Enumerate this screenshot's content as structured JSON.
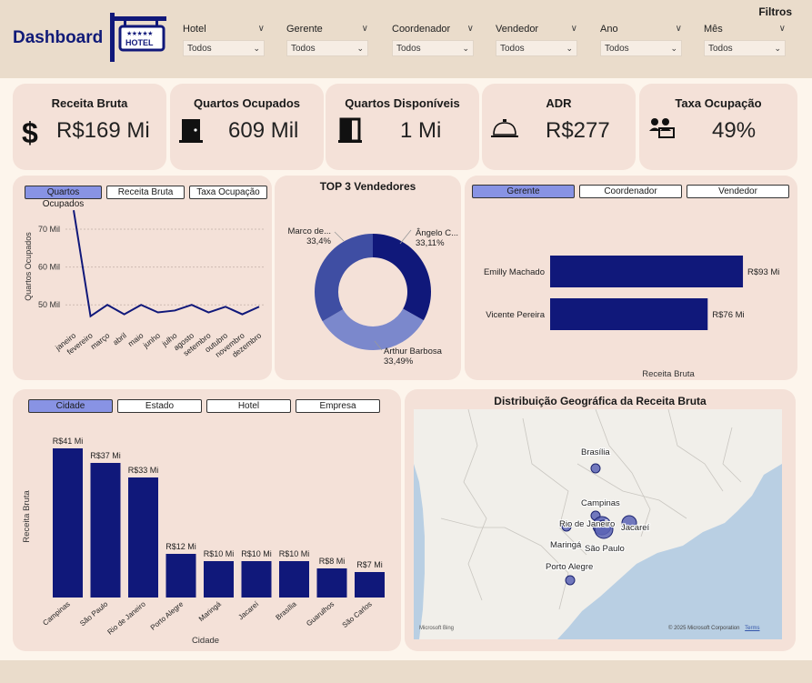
{
  "header": {
    "title": "Dashboard",
    "logo_text": "HOTEL",
    "logo_stars": "★★★★★",
    "filters_title": "Filtros",
    "filters": [
      {
        "label": "Hotel",
        "value": "Todos"
      },
      {
        "label": "Gerente",
        "value": "Todos"
      },
      {
        "label": "Coordenador",
        "value": "Todos"
      },
      {
        "label": "Vendedor",
        "value": "Todos"
      },
      {
        "label": "Ano",
        "value": "Todos"
      },
      {
        "label": "Mês",
        "value": "Todos"
      }
    ]
  },
  "kpis": [
    {
      "title": "Receita Bruta",
      "value": "R$169 Mi",
      "icon": "dollar-icon"
    },
    {
      "title": "Quartos Ocupados",
      "value": "609 Mil",
      "icon": "door-closed-icon"
    },
    {
      "title": "Quartos Disponíveis",
      "value": "1 Mi",
      "icon": "door-open-icon"
    },
    {
      "title": "ADR",
      "value": "R$277",
      "icon": "service-bell-icon"
    },
    {
      "title": "Taxa Ocupação",
      "value": "49%",
      "icon": "people-desk-icon"
    }
  ],
  "colors": {
    "navy": "#10187a",
    "mid_blue": "#3f4ea3",
    "light_blue": "#7b88cc",
    "active_tab": "#8893e4"
  },
  "line_panel": {
    "tabs": [
      "Quartos Ocupados",
      "Receita Bruta",
      "Taxa Ocupação"
    ],
    "active_tab": 0
  },
  "donut_panel": {
    "title": "TOP 3 Vendedores"
  },
  "bar_h_panel": {
    "tabs": [
      "Gerente",
      "Coordenador",
      "Vendedor"
    ],
    "active_tab": 0
  },
  "bar_v_panel": {
    "tabs": [
      "Cidade",
      "Estado",
      "Hotel",
      "Empresa"
    ],
    "active_tab": 0
  },
  "map_panel": {
    "title": "Distribuição Geográfica da Receita Bruta",
    "copyright": "© 2025 Microsoft Corporation",
    "terms": "Terms",
    "brand": "Microsoft Bing",
    "cities": [
      {
        "name": "Brasília",
        "size": "small"
      },
      {
        "name": "Campinas",
        "size": "small"
      },
      {
        "name": "Rio de Janeiro",
        "size": "large"
      },
      {
        "name": "Jacareí",
        "size": "medium"
      },
      {
        "name": "Maringá",
        "size": "small"
      },
      {
        "name": "São Paulo",
        "size": "large"
      },
      {
        "name": "Porto Alegre",
        "size": "small"
      }
    ]
  },
  "chart_data": [
    {
      "type": "line",
      "ylabel": "Quartos Ocupados",
      "xlabel": "",
      "categories": [
        "janeiro",
        "fevereiro",
        "março",
        "abril",
        "maio",
        "junho",
        "julho",
        "agosto",
        "setembro",
        "outubro",
        "novembro",
        "dezembro"
      ],
      "values": [
        75,
        47,
        50,
        47.5,
        50,
        48,
        48.5,
        50,
        48,
        49.5,
        47.5,
        49.5
      ],
      "yticks": [
        "50 Mil",
        "60 Mil",
        "70 Mil"
      ],
      "ytick_values": [
        50,
        60,
        70
      ],
      "ylim": [
        45,
        76
      ],
      "grid": true
    },
    {
      "type": "pie",
      "title": "TOP 3 Vendedores",
      "labels": [
        "Ângelo C...",
        "Arthur Barbosa",
        "Marco de..."
      ],
      "percent_labels": [
        "33,11%",
        "33,49%",
        "33,4%"
      ],
      "values": [
        33.11,
        33.49,
        33.4
      ],
      "colors": [
        "#10187a",
        "#7b88cc",
        "#3f4ea3"
      ]
    },
    {
      "type": "bar",
      "orientation": "horizontal",
      "categories": [
        "Emilly Machado",
        "Vicente Pereira"
      ],
      "values": [
        93,
        76
      ],
      "value_labels": [
        "R$93 Mi",
        "R$76 Mi"
      ],
      "xlabel": "Receita Bruta",
      "xlim": [
        0,
        100
      ]
    },
    {
      "type": "bar",
      "orientation": "vertical",
      "categories": [
        "Campinas",
        "São Paulo",
        "Rio de Janeiro",
        "Porto Alegre",
        "Maringá",
        "Jacareí",
        "Brasília",
        "Guarulhos",
        "São Carlos"
      ],
      "values": [
        41,
        37,
        33,
        12,
        10,
        10,
        10,
        8,
        7
      ],
      "value_labels": [
        "R$41 Mi",
        "R$37 Mi",
        "R$33 Mi",
        "R$12 Mi",
        "R$10 Mi",
        "R$10 Mi",
        "R$10 Mi",
        "R$8 Mi",
        "R$7 Mi"
      ],
      "xlabel": "Cidade",
      "ylabel": "Receita Bruta",
      "ylim": [
        0,
        45
      ]
    }
  ]
}
